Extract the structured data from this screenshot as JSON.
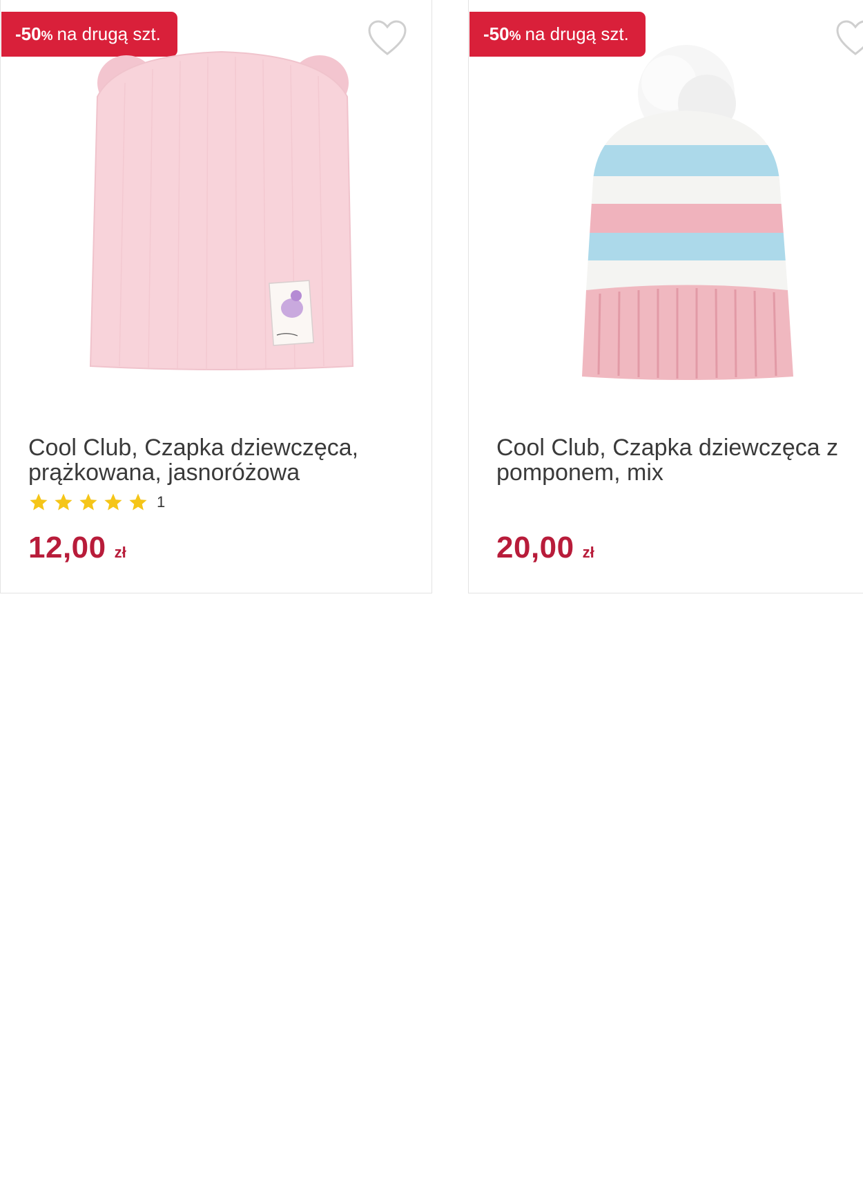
{
  "colors": {
    "badge": "#d9203a",
    "price": "#b81c3a",
    "star": "#f5c518",
    "text": "#3a3a3a"
  },
  "products": [
    {
      "badge": {
        "percent": "-50",
        "percent_sign": "%",
        "text": "na drugą szt."
      },
      "title_line1": "Cool Club, Czapka dziewczęca,",
      "title_line2": "prążkowana, jasnoróżowa",
      "rating": {
        "stars": 5,
        "count": "1"
      },
      "price": "12,00",
      "currency": "zł",
      "image_icon": "pink-beanie-with-ears"
    },
    {
      "badge": {
        "percent": "-50",
        "percent_sign": "%",
        "text": "na drugą szt."
      },
      "title_line1": "Cool Club, Czapka dziewczęca z",
      "title_line2": "pomponem, mix",
      "price": "20,00",
      "currency": "zł",
      "image_icon": "striped-pompom-hat"
    }
  ]
}
